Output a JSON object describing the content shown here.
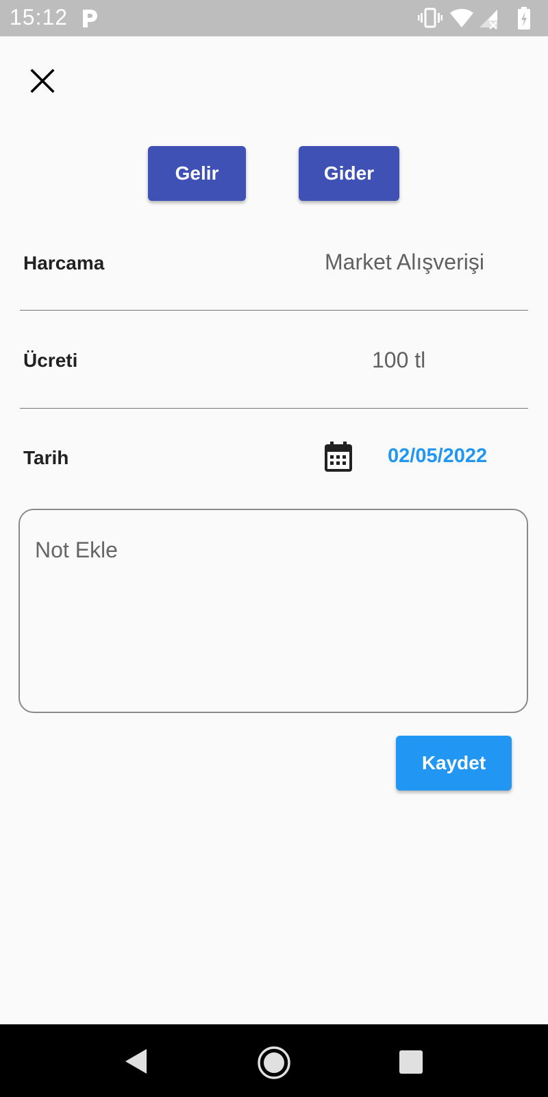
{
  "status_bar": {
    "time": "15:12",
    "icons": [
      "parking-app-icon",
      "vibrate-icon",
      "wifi-icon",
      "signal-no-data-icon",
      "battery-charging-icon"
    ]
  },
  "header": {
    "close_icon": "close-icon"
  },
  "type_buttons": {
    "income_label": "Gelir",
    "expense_label": "Gider",
    "color": "#3f51b5"
  },
  "form": {
    "expense_label": "Harcama",
    "expense_value": "Market Alışverişi",
    "amount_label": "Ücreti",
    "amount_value": "100 tl",
    "date_label": "Tarih",
    "date_icon": "calendar-icon",
    "date_value": "02/05/2022",
    "date_color": "#2196f3",
    "note_placeholder": "Not Ekle",
    "note_value": ""
  },
  "actions": {
    "save_label": "Kaydet",
    "save_color": "#2196f3"
  },
  "nav_bar": {
    "buttons": [
      "back-icon",
      "home-icon",
      "recents-icon"
    ]
  }
}
